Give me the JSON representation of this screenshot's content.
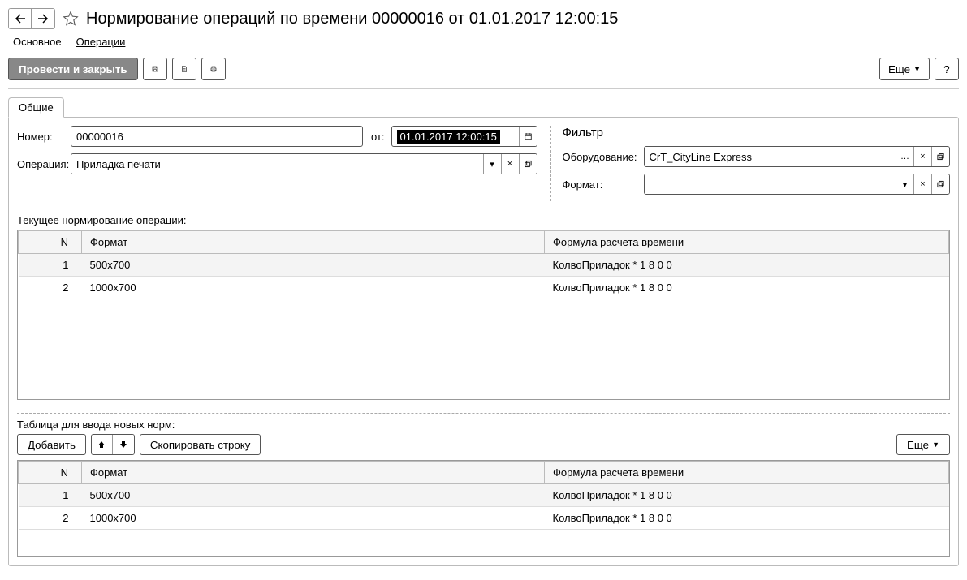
{
  "header": {
    "title": "Нормирование операций по времени 00000016 от 01.01.2017 12:00:15"
  },
  "nav_tabs": {
    "main": "Основное",
    "operations": "Операции"
  },
  "toolbar": {
    "post_close": "Провести и закрыть",
    "more": "Еще",
    "help": "?"
  },
  "doc_tabs": {
    "common": "Общие"
  },
  "form": {
    "number_label": "Номер:",
    "number_value": "00000016",
    "date_label": "от:",
    "date_value": "01.01.2017 12:00:15",
    "operation_label": "Операция:",
    "operation_value": "Приладка печати"
  },
  "filter": {
    "title": "Фильтр",
    "equipment_label": "Оборудование:",
    "equipment_value": "CrT_CityLine Express",
    "format_label": "Формат:",
    "format_value": ""
  },
  "current_section_label": "Текущее нормирование операции:",
  "new_section_label": "Таблица для ввода новых норм:",
  "table_headers": {
    "n": "N",
    "format": "Формат",
    "formula": "Формула расчета времени"
  },
  "current_rows": [
    {
      "n": "1",
      "format": "500x700",
      "formula": "КолвоПриладок * 1 8 0 0"
    },
    {
      "n": "2",
      "format": "1000x700",
      "formula": "КолвоПриладок * 1 8 0 0"
    }
  ],
  "new_rows": [
    {
      "n": "1",
      "format": "500x700",
      "formula": "КолвоПриладок * 1 8 0 0"
    },
    {
      "n": "2",
      "format": "1000x700",
      "formula": "КолвоПриладок * 1 8 0 0"
    }
  ],
  "sub_toolbar": {
    "add": "Добавить",
    "copy_row": "Скопировать строку",
    "more": "Еще"
  }
}
